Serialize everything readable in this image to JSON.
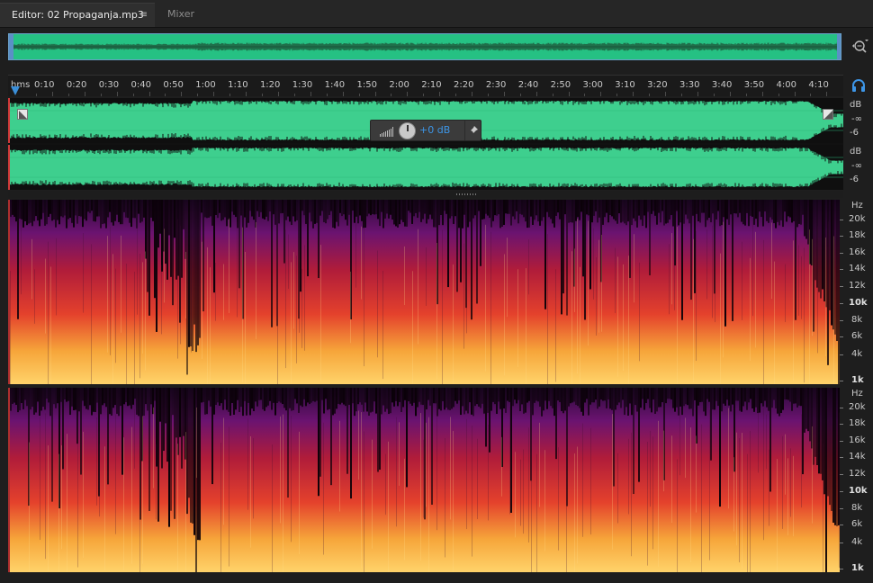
{
  "tabs": {
    "editor_label": "Editor: 02 Propaganja.mp3",
    "menu_icon": "≡",
    "mixer_label": "Mixer"
  },
  "ruler": {
    "unit": "hms",
    "labels": [
      "0:10",
      "0:20",
      "0:30",
      "0:40",
      "0:50",
      "1:00",
      "1:10",
      "1:20",
      "1:30",
      "1:40",
      "1:50",
      "2:00",
      "2:10",
      "2:20",
      "2:30",
      "2:40",
      "2:50",
      "3:00",
      "3:10",
      "3:20",
      "3:30",
      "3:40",
      "3:50",
      "4:00",
      "4:10"
    ]
  },
  "hud": {
    "gain_text": "+0 dB",
    "pin_icon": "pin-icon"
  },
  "waveform_scale": {
    "channel1": [
      "dB",
      "-∞",
      "-6"
    ],
    "channel2": [
      "dB",
      "-∞",
      "-6"
    ]
  },
  "spectral_scale": {
    "unit": "Hz",
    "labels": [
      "20k",
      "18k",
      "16k",
      "14k",
      "12k",
      "10k",
      "8k",
      "6k",
      "4k",
      "1k"
    ],
    "bold": [
      "10k",
      "1k"
    ]
  },
  "colors": {
    "waveform": "#3ecf8e",
    "overview": "#25c183",
    "accent": "#3d95e6",
    "selection_line": "#d23a3a"
  }
}
